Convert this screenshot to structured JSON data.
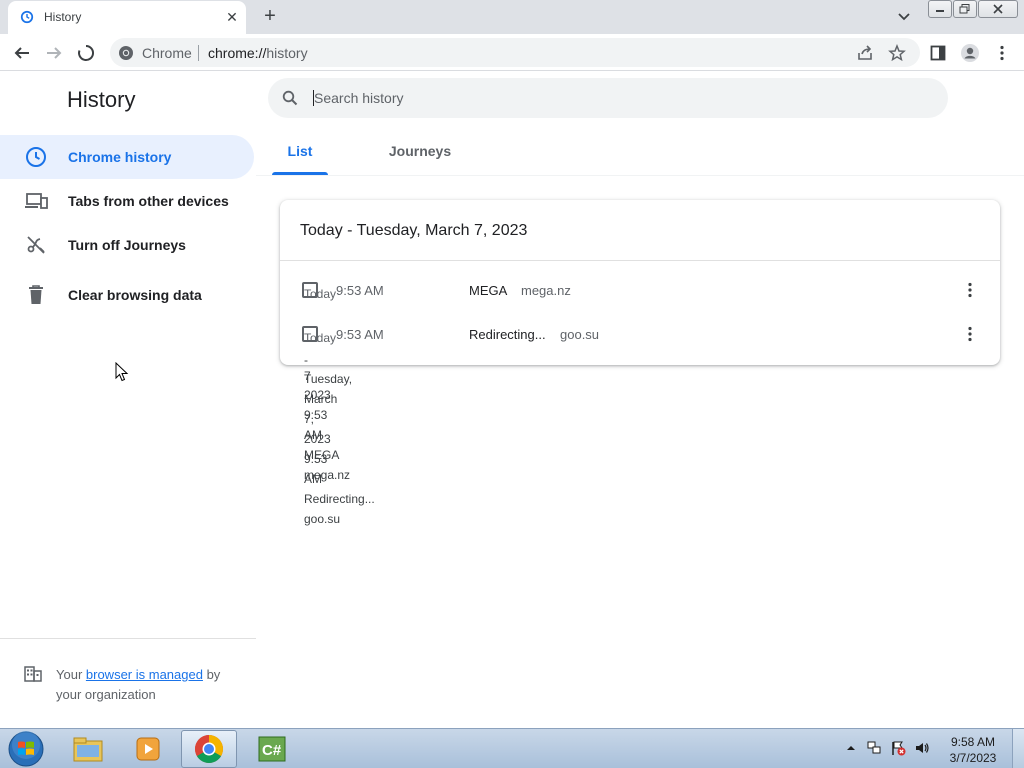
{
  "browser": {
    "tab_title": "History",
    "tab_close_glyph": "✕",
    "new_tab_glyph": "+",
    "omnibox": {
      "chip_label": "Chrome",
      "url_scheme": "chrome://",
      "url_path": "history"
    }
  },
  "sidebar": {
    "title": "History",
    "items": [
      {
        "label": "Chrome history",
        "icon": "clock-icon",
        "active": true
      },
      {
        "label": "Tabs from other devices",
        "icon": "devices-icon",
        "active": false
      },
      {
        "label": "Turn off Journeys",
        "icon": "journeys-off-icon",
        "active": false
      },
      {
        "label": "Clear browsing data",
        "icon": "trash-icon",
        "active": false
      }
    ],
    "managed": {
      "prefix": "Your ",
      "link": "browser is managed",
      "suffix": " by your organization"
    }
  },
  "search": {
    "placeholder": "Search history",
    "value": ""
  },
  "tabs": [
    {
      "label": "List",
      "selected": true
    },
    {
      "label": "Journeys",
      "selected": false
    }
  ],
  "history": {
    "date_header": "Today - Tuesday, March 7, 2023",
    "entries": [
      {
        "checkbox_label": "Today",
        "time": "9:53 AM",
        "title": "MEGA",
        "domain": "mega.nz"
      },
      {
        "checkbox_label": "Today",
        "time": "9:53 AM",
        "title": "Redirecting...",
        "domain": "goo.su"
      }
    ]
  },
  "leaked_text": {
    "col_a": [
      "-",
      "7",
      "Tuesday,",
      "2023",
      "March",
      "9:53",
      "7,",
      "AM",
      "2023",
      "9:53",
      "MEGA",
      "mega.nz",
      "AM",
      "Redirecting...",
      "goo.su"
    ]
  },
  "taskbar": {
    "apps": [
      "windows-explorer-icon",
      "media-player-icon",
      "chrome-icon",
      "csharp-icon"
    ],
    "time": "9:58 AM",
    "date": "3/7/2023"
  },
  "colors": {
    "accent": "#1a73e8",
    "active_bg": "#e8f0fe",
    "tabstrip": "#dee1e6",
    "taskbar": "#b9cde3"
  }
}
